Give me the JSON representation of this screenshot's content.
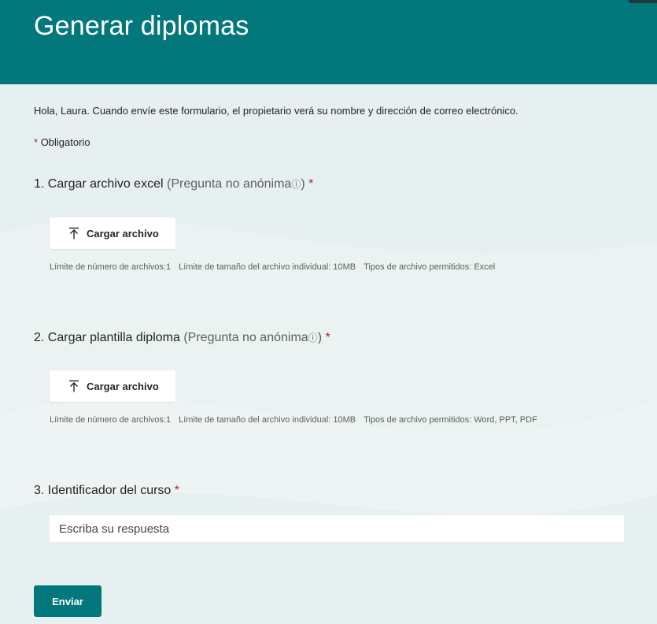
{
  "header": {
    "title": "Generar diplomas"
  },
  "greeting": "Hola, Laura. Cuando envíe este formulario, el propietario verá su nombre y dirección de correo electrónico.",
  "required_note": {
    "star": "*",
    "text": "Obligatorio"
  },
  "questions": [
    {
      "number": "1.",
      "title": "Cargar archivo excel",
      "sub": "(Pregunta no anónima",
      "info": "ⓘ",
      "sub_close": ")",
      "star": "*",
      "upload_label": "Cargar archivo",
      "limits": [
        "Límite de número de archivos:1",
        "Límite de tamaño del archivo individual: 10MB",
        "Tipos de archivo permitidos: Excel"
      ]
    },
    {
      "number": "2.",
      "title": "Cargar plantilla diploma",
      "sub": "(Pregunta no anónima",
      "info": "ⓘ",
      "sub_close": ")",
      "star": "*",
      "upload_label": "Cargar archivo",
      "limits": [
        "Límite de número de archivos:1",
        "Límite de tamaño del archivo individual: 10MB",
        "Tipos de archivo permitidos: Word, PPT, PDF"
      ]
    },
    {
      "number": "3.",
      "title": "Identificador del curso",
      "star": "*",
      "placeholder": "Escriba su respuesta",
      "value": ""
    }
  ],
  "submit_label": "Enviar",
  "colors": {
    "brand": "#03787c",
    "required": "#a4262c",
    "background": "#e6f0f0"
  },
  "icons": {
    "upload": "upload-arrow-icon",
    "info": "info-icon"
  }
}
